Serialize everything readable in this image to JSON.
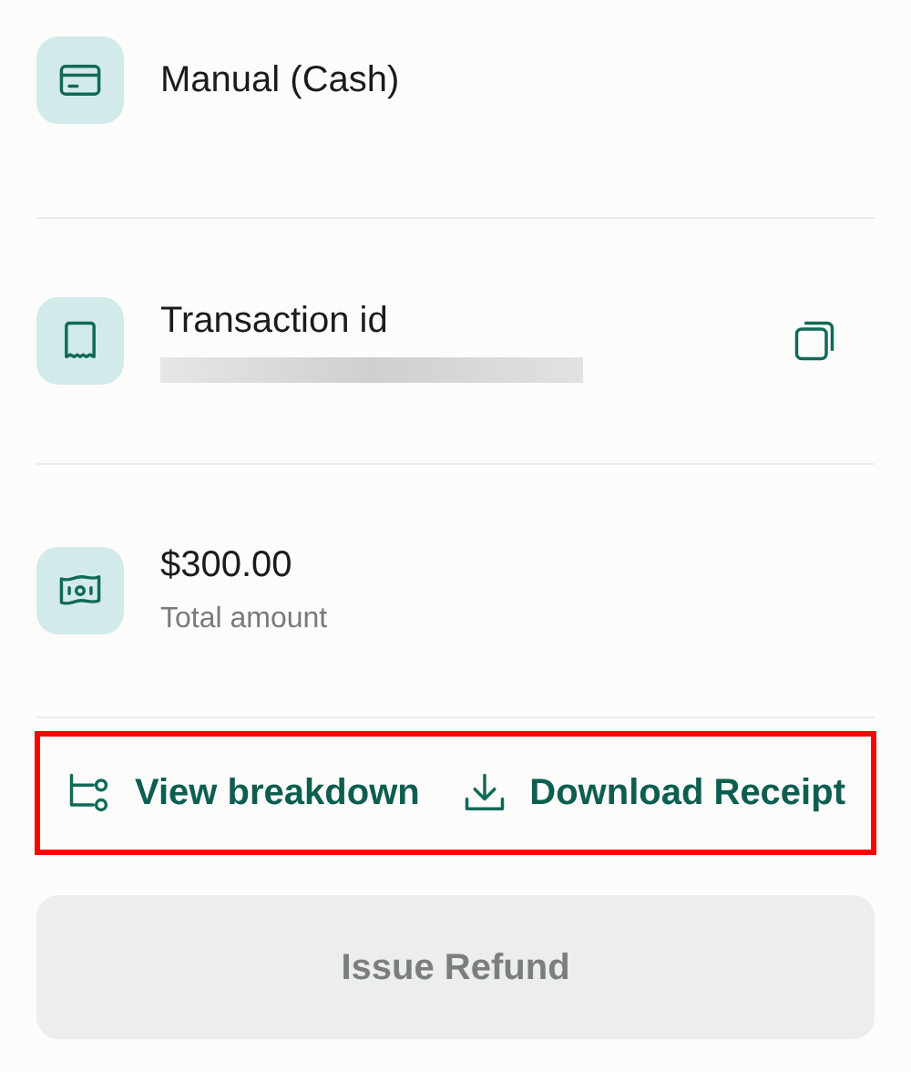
{
  "details": [
    {
      "kind": "payment_method",
      "title": "Manual (Cash)"
    },
    {
      "kind": "transaction",
      "title": "Transaction id",
      "value_redacted": true
    },
    {
      "kind": "amount",
      "title": "$300.00",
      "subtitle": "Total amount"
    }
  ],
  "actions": {
    "highlighted": true,
    "items": [
      {
        "kind": "breakdown",
        "label": "View breakdown"
      },
      {
        "kind": "download",
        "label": "Download Receipt"
      }
    ]
  },
  "refund_button": {
    "label": "Issue Refund",
    "disabled": true
  }
}
